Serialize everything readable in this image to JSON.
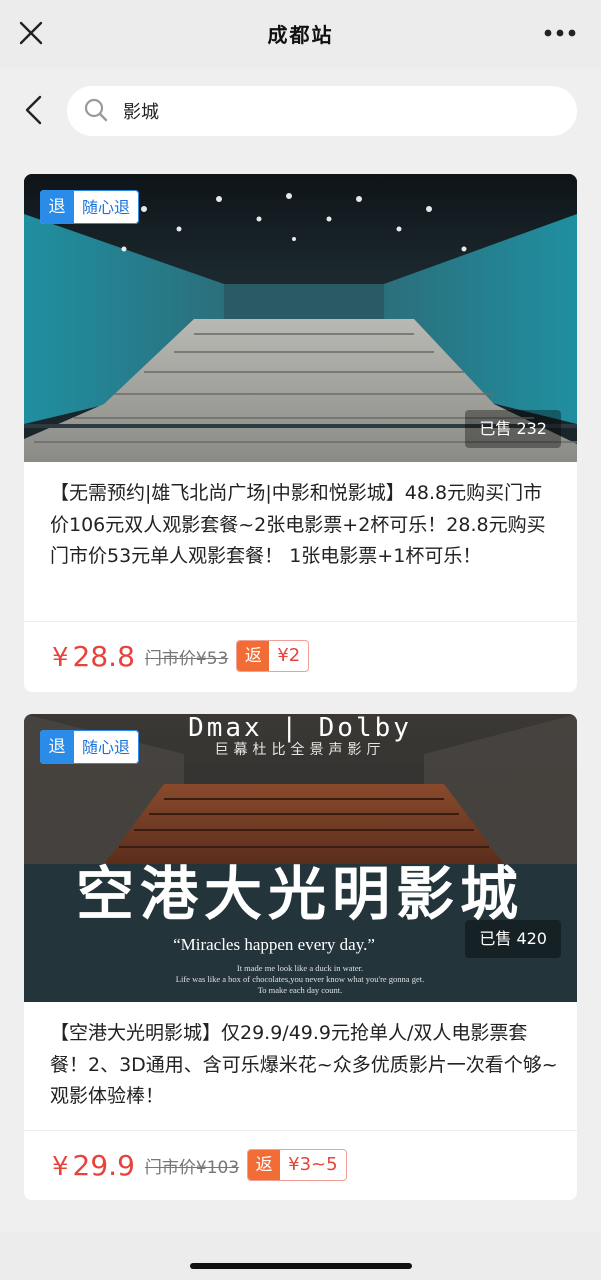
{
  "header": {
    "title": "成都站",
    "close_icon": "close-icon",
    "more_icon": "more-icon"
  },
  "search": {
    "back_icon": "back-icon",
    "search_icon": "search-icon",
    "query": "影城"
  },
  "listings": [
    {
      "tag_icon": "退",
      "tag_label": "随心退",
      "sold": "已售 232",
      "description": "【无需预约|雄飞北尚广场|中影和悦影城】48.8元购买门市价106元双人观影套餐~2张电影票+2杯可乐！28.8元购买门市价53元单人观影套餐！ 1张电影票+1杯可乐！",
      "price_symbol": "¥",
      "price": "28.8",
      "market_price": "门市价¥53",
      "rebate_icon": "返",
      "rebate_amount": "¥2"
    },
    {
      "tag_icon": "退",
      "tag_label": "随心退",
      "sold": "已售 420",
      "image_text": {
        "top": "Dmax | Dolby",
        "sub": "巨幕杜比全景声影厅",
        "big": "空港大光明影城",
        "quote": "“Miracles happen every day.”",
        "line1": "It made me look like a duck in water.",
        "line2": "Life was like a box of chocolates,you never know what you're gonna get.",
        "line3": "To make each day count."
      },
      "description": "【空港大光明影城】仅29.9/49.9元抢单人/双人电影票套餐！2、3D通用、含可乐爆米花~众多优质影片一次看个够~观影体验棒！",
      "price_symbol": "¥",
      "price": "29.9",
      "market_price": "门市价¥103",
      "rebate_icon": "返",
      "rebate_amount": "¥3~5"
    }
  ],
  "colors": {
    "price": "#e8433b",
    "tag_blue": "#2b8be8",
    "rebate_orange": "#f26c36"
  }
}
